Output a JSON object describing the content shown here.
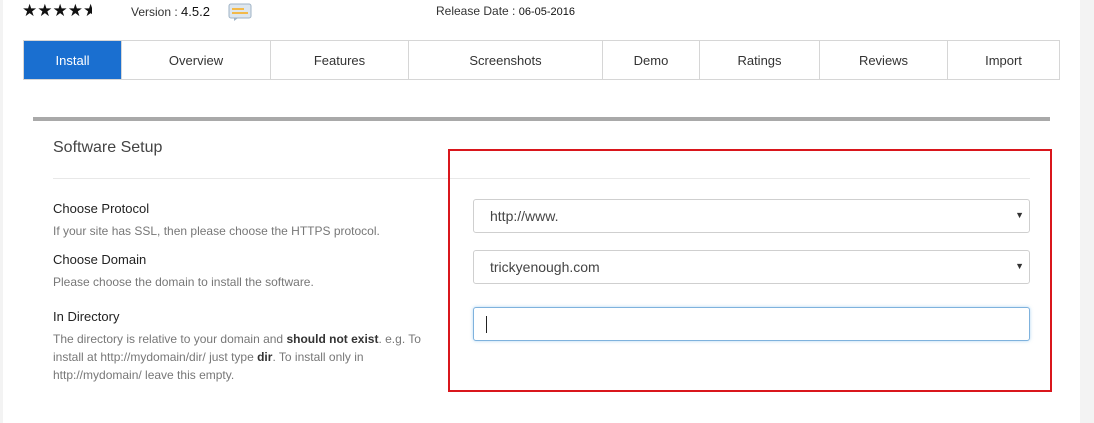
{
  "header": {
    "stars": "★★★★",
    "half_star": "★",
    "version_label": "Version :",
    "version_value": "4.5.2",
    "release_label": "Release Date :",
    "release_value": "06-05-2016"
  },
  "tabs": [
    {
      "label": "Install",
      "active": true
    },
    {
      "label": "Overview"
    },
    {
      "label": "Features"
    },
    {
      "label": "Screenshots"
    },
    {
      "label": "Demo"
    },
    {
      "label": "Ratings"
    },
    {
      "label": "Reviews"
    },
    {
      "label": "Import"
    }
  ],
  "setup": {
    "title": "Software Setup",
    "protocol": {
      "label": "Choose Protocol",
      "help": "If your site has SSL, then please choose the HTTPS protocol.",
      "value": "http://www."
    },
    "domain": {
      "label": "Choose Domain",
      "help": "Please choose the domain to install the software.",
      "value": "trickyenough.com"
    },
    "directory": {
      "label": "In Directory",
      "help_1": "The directory is relative to your domain and ",
      "help_bold_1": "should not exist",
      "help_2": ". e.g. To install at http://mydomain/dir/ just type ",
      "help_bold_2": "dir",
      "help_3": ". To install only in http://mydomain/ leave this empty.",
      "value": ""
    }
  },
  "colors": {
    "accent": "#1a6fd0",
    "highlight": "#d9161c"
  }
}
